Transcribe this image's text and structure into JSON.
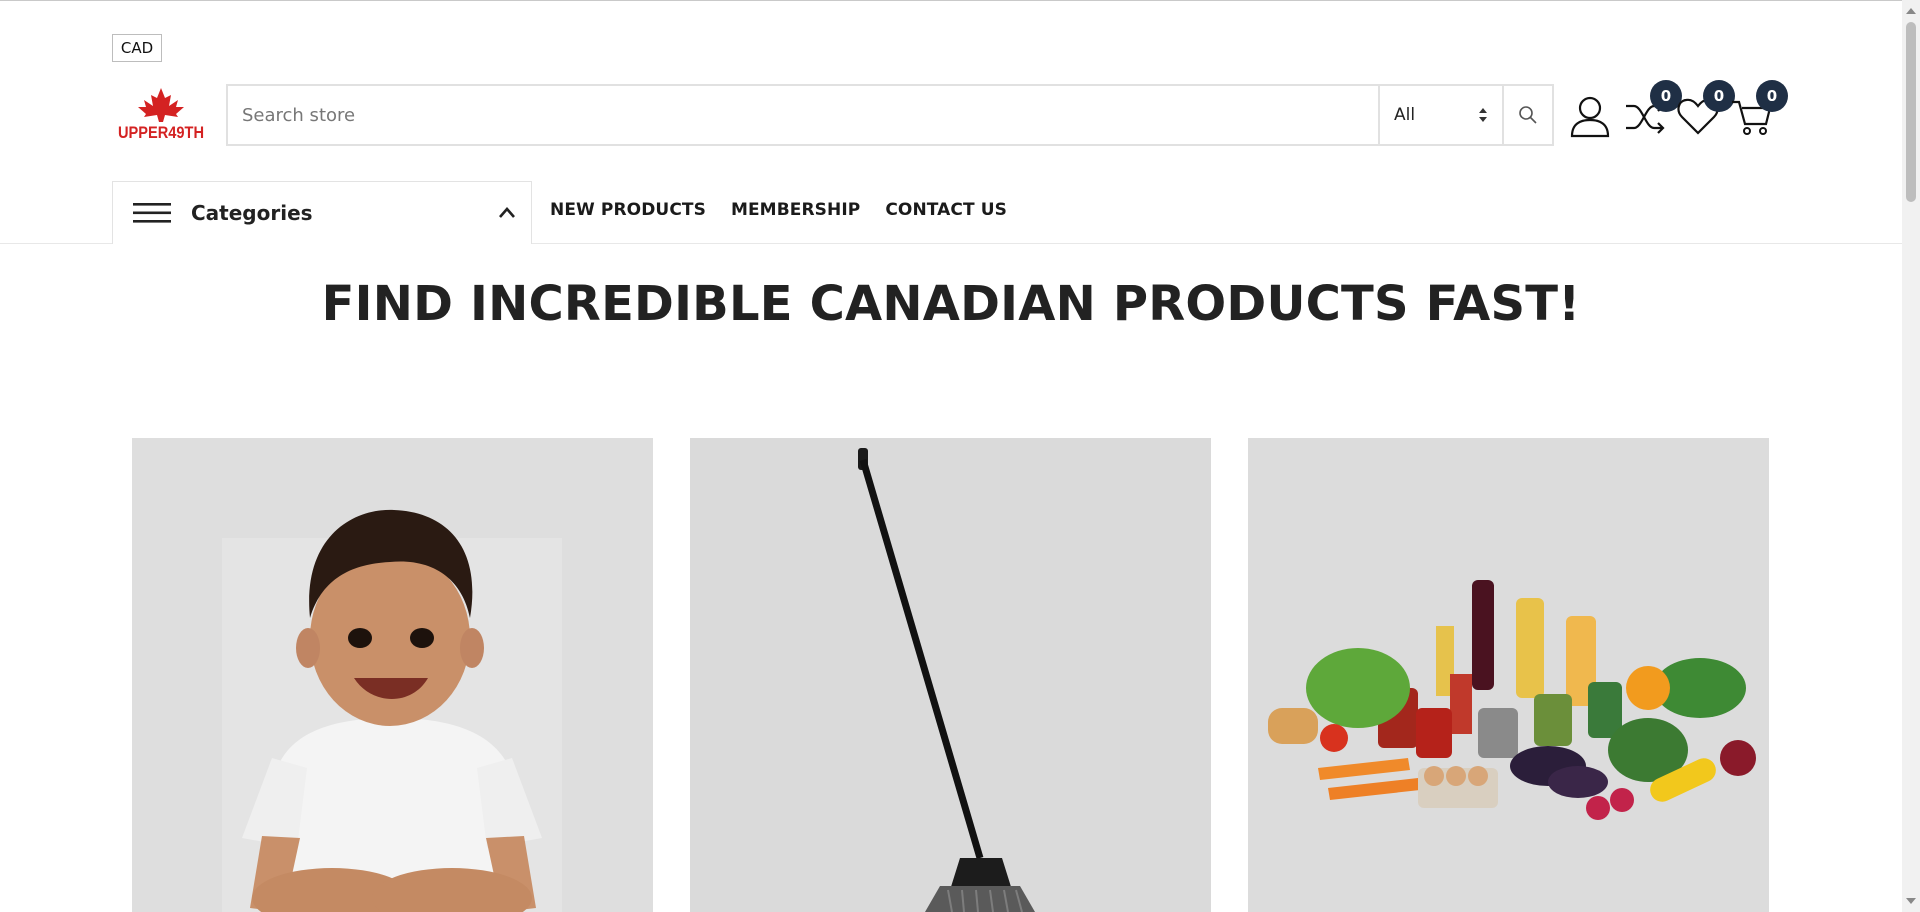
{
  "header": {
    "currency": "CAD",
    "logo_text": "UPPER49TH",
    "search": {
      "placeholder": "Search store",
      "category_selected": "All"
    },
    "counters": {
      "compare": "0",
      "wishlist": "0",
      "cart": "0"
    }
  },
  "nav": {
    "categories_label": "Categories",
    "menu_items": [
      "NEW PRODUCTS",
      "MEMBERSHIP",
      "CONTACT US"
    ]
  },
  "hero": {
    "title": "FIND INCREDIBLE CANADIAN PRODUCTS FAST!"
  },
  "tiles": [
    {
      "image": "baby-photo"
    },
    {
      "image": "broom-photo"
    },
    {
      "image": "groceries-photo"
    }
  ],
  "colors": {
    "badge_bg": "#1f2f45",
    "logo_red": "#d42222",
    "tile_bg": "#dcdcdc"
  }
}
